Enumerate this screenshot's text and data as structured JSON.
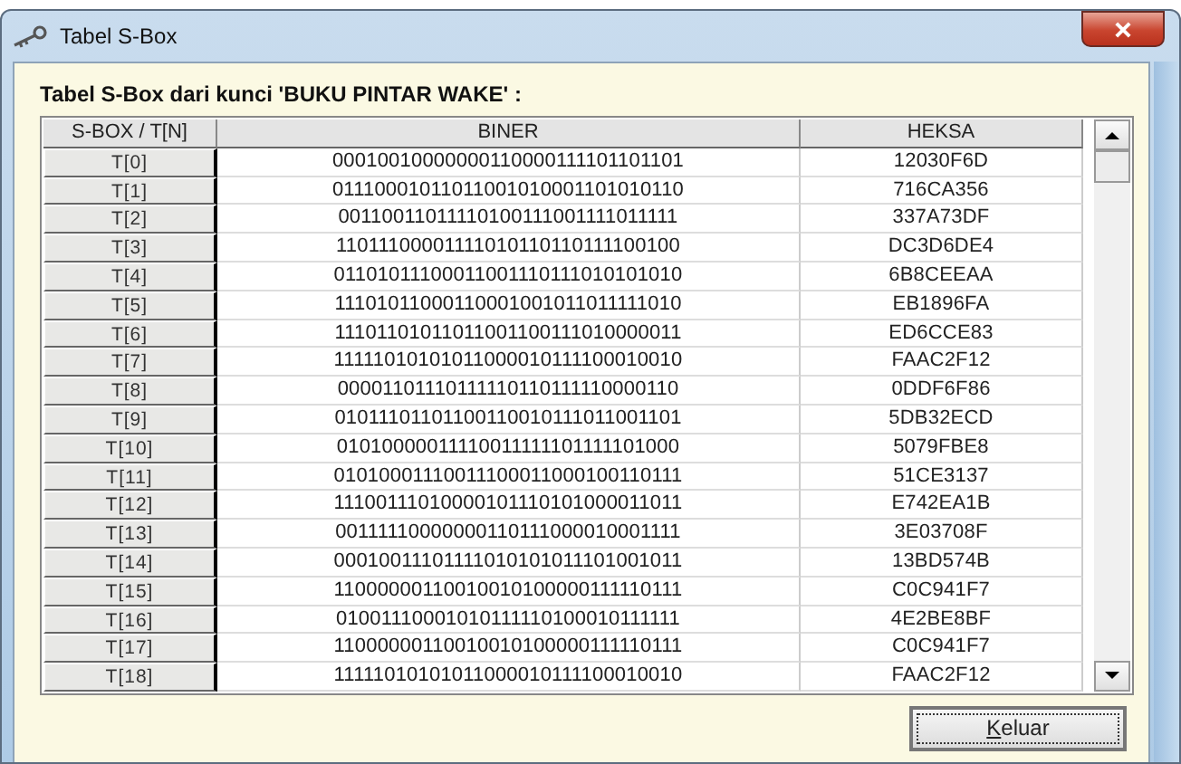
{
  "window": {
    "title": "Tabel S-Box"
  },
  "caption": "Tabel S-Box dari kunci 'BUKU PINTAR WAKE' :",
  "table": {
    "columns": [
      "S-BOX / T[N]",
      "BINER",
      "HEKSA"
    ],
    "rows": [
      [
        "T[0]",
        "00010010000000110000111101101101",
        "12030F6D"
      ],
      [
        "T[1]",
        "01110001011011001010001101010110",
        "716CA356"
      ],
      [
        "T[2]",
        "00110011011110100111001111011111",
        "337A73DF"
      ],
      [
        "T[3]",
        "11011100001111010110110111100100",
        "DC3D6DE4"
      ],
      [
        "T[4]",
        "01101011100011001110111010101010",
        "6B8CEEAA"
      ],
      [
        "T[5]",
        "11101011000110001001011011111010",
        "EB1896FA"
      ],
      [
        "T[6]",
        "11101101011011001100111010000011",
        "ED6CCE83"
      ],
      [
        "T[7]",
        "11111010101011000010111100010010",
        "FAAC2F12"
      ],
      [
        "T[8]",
        "00001101110111110110111110000110",
        "0DDF6F86"
      ],
      [
        "T[9]",
        "01011101101100110010111011001101",
        "5DB32ECD"
      ],
      [
        "T[10]",
        "01010000011110011111101111101000",
        "5079FBE8"
      ],
      [
        "T[11]",
        "01010001110011100011000100110111",
        "51CE3137"
      ],
      [
        "T[12]",
        "11100111010000101110101000011011",
        "E742EA1B"
      ],
      [
        "T[13]",
        "00111110000000110111000010001111",
        "3E03708F"
      ],
      [
        "T[14]",
        "00010011101111010101011101001011",
        "13BD574B"
      ],
      [
        "T[15]",
        "11000000110010010100000111110111",
        "C0C941F7"
      ],
      [
        "T[16]",
        "01001110001010111110100010111111",
        "4E2BE8BF"
      ],
      [
        "T[17]",
        "11000000110010010100000111110111",
        "C0C941F7"
      ],
      [
        "T[18]",
        "11111010101011000010111100010010",
        "FAAC2F12"
      ]
    ]
  },
  "buttons": [
    "Keluar"
  ]
}
